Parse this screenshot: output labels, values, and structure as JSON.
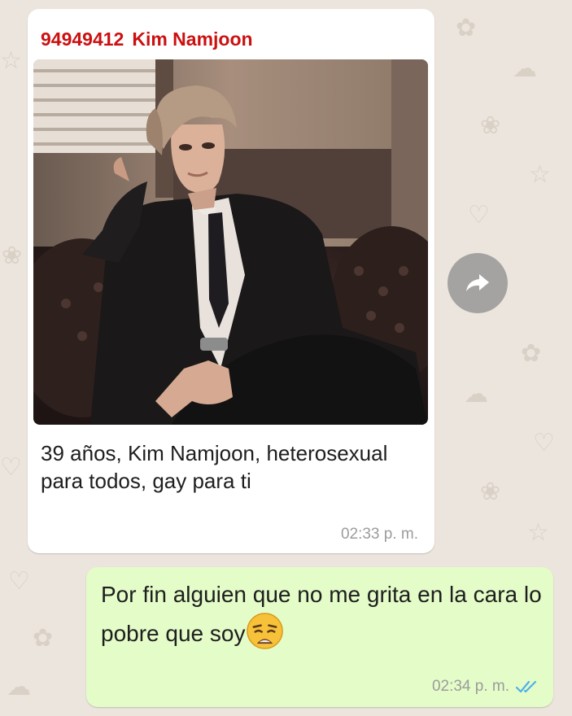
{
  "incoming": {
    "sender_phone": "94949412",
    "sender_name": "Kim Namjoon",
    "image_icon": "photo",
    "caption": "39 años, Kim Namjoon, heterosexual para todos, gay para ti",
    "time": "02:33 p. m."
  },
  "forward_button": {
    "icon": "forward-arrow-icon"
  },
  "outgoing": {
    "text": "Por fin alguien que no me grita en la cara lo pobre que soy",
    "emoji": "weary-face-emoji",
    "time": "02:34 p. m.",
    "status_icon": "double-check-read-icon",
    "status_color": "#4fb0e8"
  },
  "colors": {
    "sender_name": "#cc1010",
    "incoming_bubble": "#ffffff",
    "outgoing_bubble": "#e4fcc8",
    "background": "#ece5dd"
  }
}
